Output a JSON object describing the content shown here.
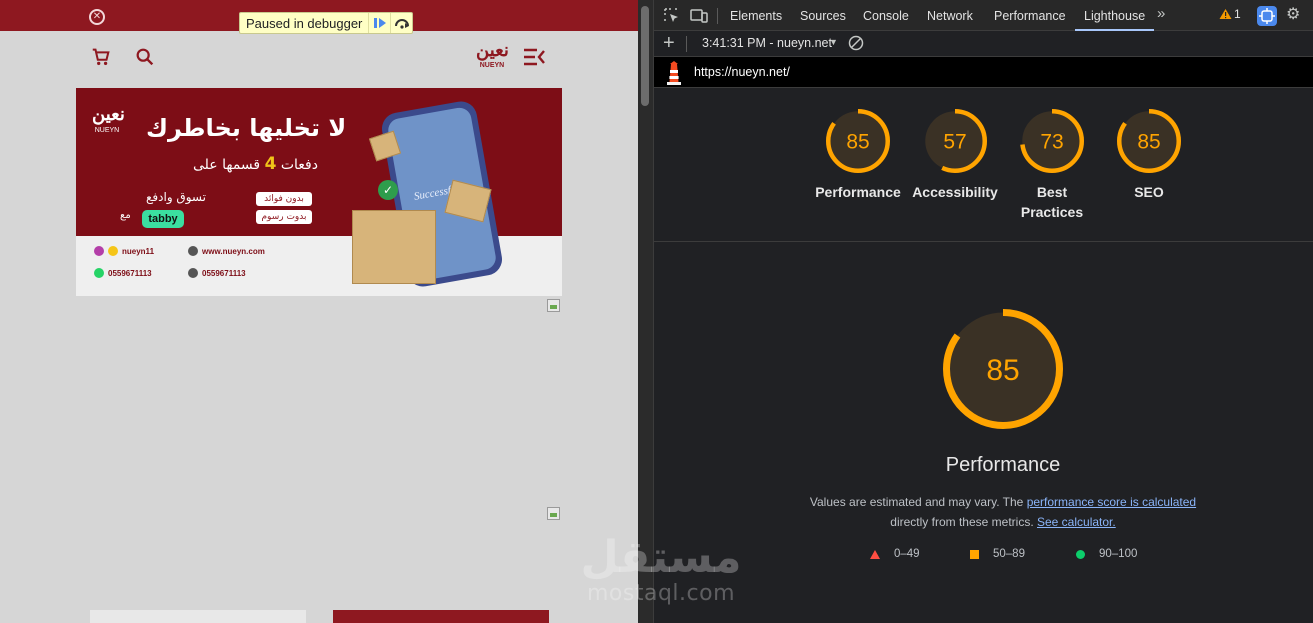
{
  "debugger": {
    "label": "Paused in debugger"
  },
  "site": {
    "logo_ar": "نعين",
    "logo_en": "NUEYN",
    "banner": {
      "headline": "لا تخليها بخاطرك",
      "split_prefix": "قسمها على",
      "split_number": "4",
      "split_suffix": "دفعات",
      "shop_pay": "تسوق وادفع",
      "with": "مع",
      "tabby": "tabby",
      "chip1": "بدون فوائد",
      "chip2": "بدوت رسوم",
      "success": "Successful",
      "contact_snap": "nueyn11",
      "contact_web": "www.nueyn.com",
      "contact_whatsapp": "0559671113",
      "contact_phone": "0559671113"
    }
  },
  "devtools": {
    "tabs": [
      "Elements",
      "Sources",
      "Console",
      "Network",
      "Performance",
      "Lighthouse"
    ],
    "active_tab": "Lighthouse",
    "warning_count": "1",
    "report_label": "3:41:31 PM - nueyn.net",
    "url": "https://nueyn.net/",
    "scores": [
      {
        "label": "Performance",
        "score": 85
      },
      {
        "label": "Accessibility",
        "score": 57
      },
      {
        "label": "Best Practices",
        "score": 73
      },
      {
        "label": "SEO",
        "score": 85
      }
    ],
    "detail": {
      "score": 85,
      "title": "Performance",
      "note_prefix": "Values are estimated and may vary. The",
      "note_link1": "performance score is calculated",
      "note_middle": "directly from these metrics.",
      "note_link2": "See calculator."
    },
    "legend": {
      "fail": "0–49",
      "average": "50–89",
      "pass": "90–100"
    },
    "colors": {
      "average": "#ffa400",
      "fail": "#ff4e42",
      "pass": "#0cce6b",
      "gauge_bg": "#3a3125",
      "link": "#8ab4f8"
    }
  },
  "watermark": {
    "ar": "مستقل",
    "en": "mostaql.com"
  }
}
